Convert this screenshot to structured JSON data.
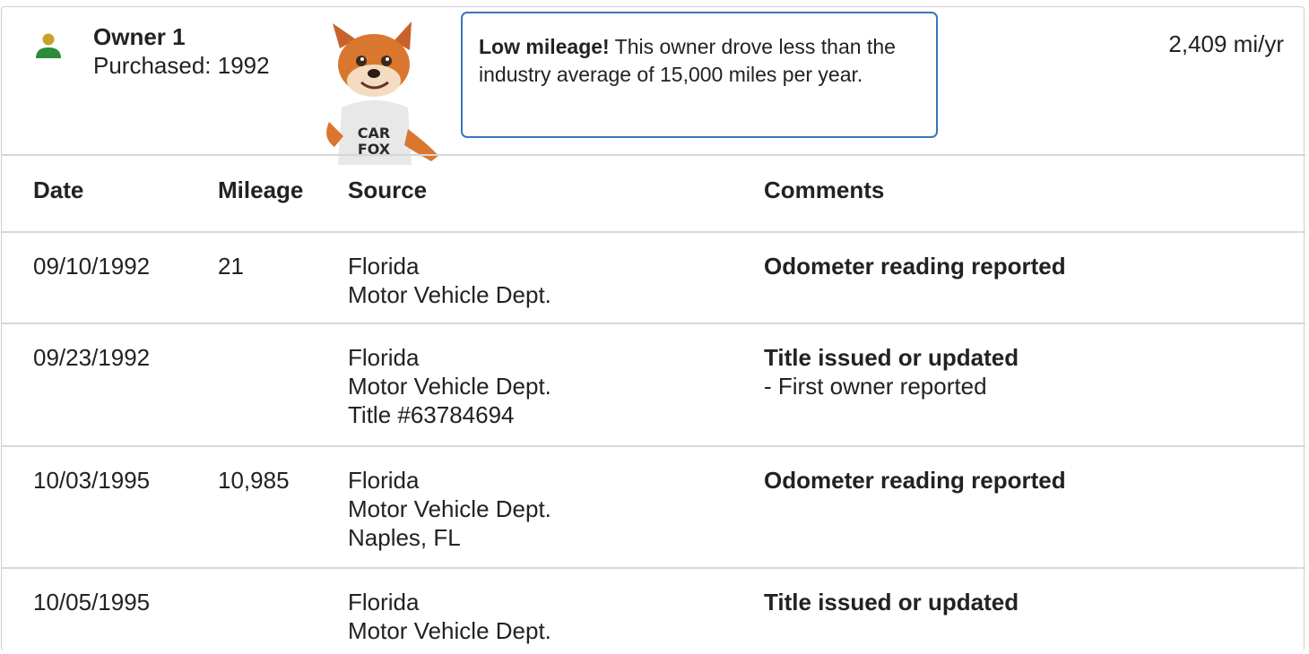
{
  "owner": {
    "name": "Owner 1",
    "purchased": "Purchased: 1992",
    "miles_per_year": "2,409 mi/yr",
    "icon": "person-icon",
    "icon_colors": {
      "head": "#c9a227",
      "body": "#2e8b3d"
    }
  },
  "mascot": {
    "shirt_text_1": "CAR",
    "shirt_text_2": "FOX"
  },
  "callout": {
    "bold": "Low mileage!",
    "text": " This owner drove less than the industry average of 15,000 miles per year."
  },
  "table": {
    "headers": {
      "date": "Date",
      "mileage": "Mileage",
      "source": "Source",
      "comments": "Comments"
    },
    "rows": [
      {
        "date": "09/10/1992",
        "mileage": "21",
        "source": [
          "Florida",
          "Motor Vehicle Dept."
        ],
        "comment_title": "Odometer reading reported",
        "comment_detail": ""
      },
      {
        "date": "09/23/1992",
        "mileage": "",
        "source": [
          "Florida",
          "Motor Vehicle Dept.",
          "Title #63784694"
        ],
        "comment_title": "Title issued or updated",
        "comment_detail": "- First owner reported"
      },
      {
        "date": "10/03/1995",
        "mileage": "10,985",
        "source": [
          "Florida",
          "Motor Vehicle Dept.",
          "Naples, FL"
        ],
        "comment_title": "Odometer reading reported",
        "comment_detail": ""
      },
      {
        "date": "10/05/1995",
        "mileage": "",
        "source": [
          "Florida",
          "Motor Vehicle Dept."
        ],
        "comment_title": "Title issued or updated",
        "comment_detail": ""
      }
    ]
  },
  "colors": {
    "accent_border": "#3777bc",
    "divider": "#d8d8d8"
  }
}
